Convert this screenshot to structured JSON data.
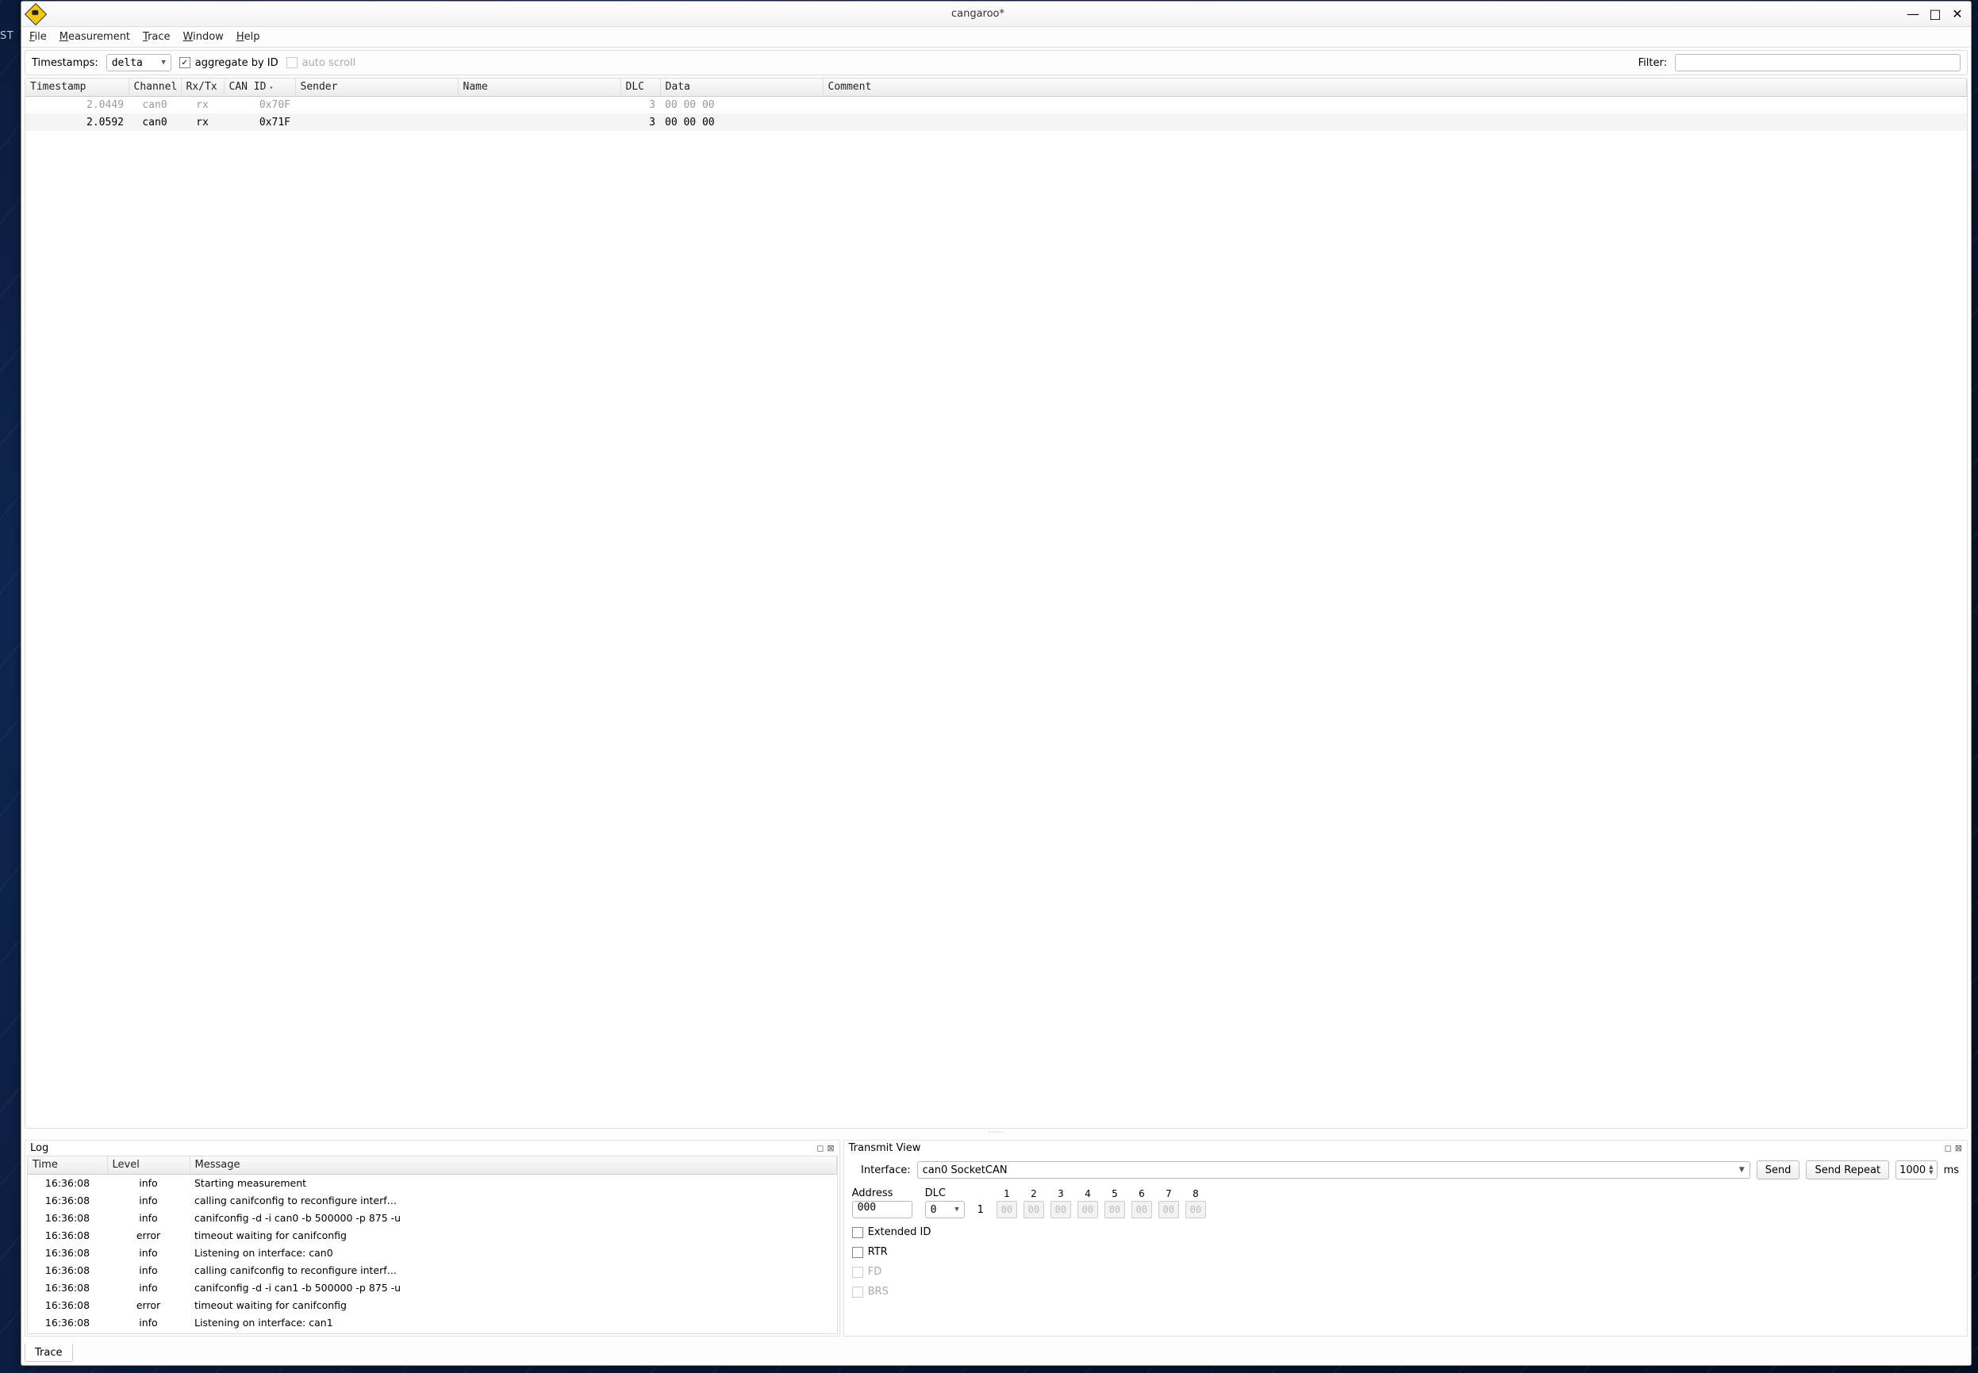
{
  "window": {
    "title": "cangaroo*"
  },
  "menu": [
    "File",
    "Measurement",
    "Trace",
    "Window",
    "Help"
  ],
  "toolbar": {
    "timestamps_label": "Timestamps:",
    "timestamps_value": "delta",
    "aggregate_label": "aggregate by ID",
    "aggregate_checked": true,
    "autoscroll_label": "auto scroll",
    "autoscroll_checked": false,
    "filter_label": "Filter:",
    "filter_value": ""
  },
  "trace": {
    "columns": [
      "Timestamp",
      "Channel",
      "Rx/Tx",
      "CAN ID",
      "Sender",
      "Name",
      "DLC",
      "Data",
      "Comment"
    ],
    "sort_col_index": 3,
    "rows": [
      {
        "ts": "2.0449",
        "ch": "can0",
        "rxtx": "rx",
        "id": "0x70F",
        "sender": "",
        "name": "",
        "dlc": "3",
        "data": "00 00 00",
        "comment": "",
        "dim": true
      },
      {
        "ts": "2.0592",
        "ch": "can0",
        "rxtx": "rx",
        "id": "0x71F",
        "sender": "",
        "name": "",
        "dlc": "3",
        "data": "00 00 00",
        "comment": "",
        "dim": false
      }
    ]
  },
  "log": {
    "title": "Log",
    "columns": [
      "Time",
      "Level",
      "Message"
    ],
    "rows": [
      {
        "t": "16:36:08",
        "lvl": "info",
        "msg": "Starting measurement"
      },
      {
        "t": "16:36:08",
        "lvl": "info",
        "msg": "calling canifconfig to reconfigure interf…"
      },
      {
        "t": "16:36:08",
        "lvl": "info",
        "msg": "canifconfig -d -i can0 -b 500000 -p 875 -u"
      },
      {
        "t": "16:36:08",
        "lvl": "error",
        "msg": "timeout waiting for canifconfig"
      },
      {
        "t": "16:36:08",
        "lvl": "info",
        "msg": "Listening on interface: can0"
      },
      {
        "t": "16:36:08",
        "lvl": "info",
        "msg": "calling canifconfig to reconfigure interf…"
      },
      {
        "t": "16:36:08",
        "lvl": "info",
        "msg": "canifconfig -d -i can1 -b 500000 -p 875 -u"
      },
      {
        "t": "16:36:08",
        "lvl": "error",
        "msg": "timeout waiting for canifconfig"
      },
      {
        "t": "16:36:08",
        "lvl": "info",
        "msg": "Listening on interface: can1"
      }
    ]
  },
  "tx": {
    "title": "Transmit View",
    "interface_label": "Interface:",
    "interface_value": "can0 SocketCAN",
    "send_label": "Send",
    "send_repeat_label": "Send Repeat",
    "repeat_ms": "1000",
    "ms_label": "ms",
    "address_label": "Address",
    "address_value": "000",
    "dlc_label": "DLC",
    "dlc_value": "0",
    "byte_headers": [
      "1",
      "2",
      "3",
      "4",
      "5",
      "6",
      "7",
      "8"
    ],
    "byte_placeholder": "00",
    "row_num": "1",
    "ext_id_label": "Extended ID",
    "rtr_label": "RTR",
    "fd_label": "FD",
    "brs_label": "BRS"
  },
  "tabs": {
    "trace": "Trace"
  },
  "desktop_text": "ST"
}
